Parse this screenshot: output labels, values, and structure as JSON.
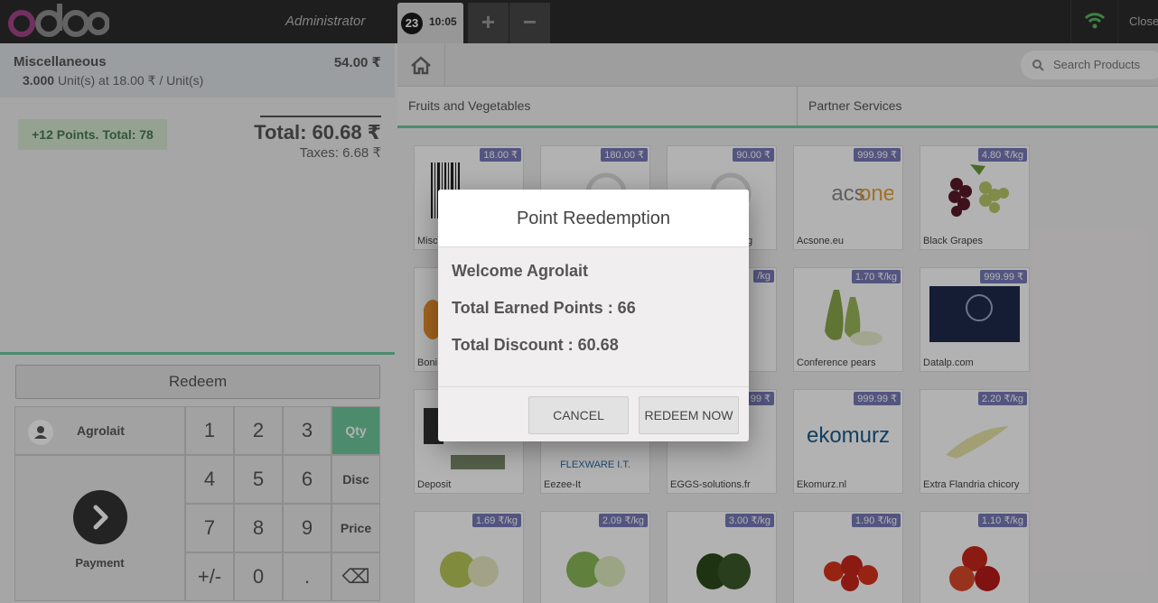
{
  "topbar": {
    "logo_text": "odoo",
    "cashier": "Administrator",
    "order_number": "23",
    "order_time": "10:05",
    "add_order_label": "+",
    "remove_order_label": "−",
    "close_label": "Close"
  },
  "order": {
    "line": {
      "product": "Miscellaneous",
      "price": "54.00 ₹",
      "quantity": "3.000",
      "info": "Unit(s) at 18.00 ₹ / Unit(s)"
    },
    "loyalty": "+12 Points. Total: 78",
    "total": "Total: 60.68 ₹",
    "taxes": "Taxes: 6.68 ₹"
  },
  "actions": {
    "redeem": "Redeem",
    "customer": "Agrolait",
    "payment": "Payment"
  },
  "numpad": {
    "keys": [
      "1",
      "2",
      "3",
      "4",
      "5",
      "6",
      "7",
      "8",
      "9",
      "+/-",
      "0",
      "."
    ],
    "modes": [
      "Qty",
      "Disc",
      "Price"
    ],
    "backspace": "⌫"
  },
  "search": {
    "placeholder": "Search Products"
  },
  "categories": [
    "Fruits and Vegetables",
    "Partner Services"
  ],
  "products": [
    {
      "name": "Miscellaneous",
      "price": "18.00 ₹"
    },
    {
      "name": "",
      "price": "180.00 ₹"
    },
    {
      "name": "",
      "price": "90.00 ₹"
    },
    {
      "name": "Acsone.eu",
      "price": "999.99 ₹"
    },
    {
      "name": "Black Grapes",
      "price": "4.80 ₹/kg"
    },
    {
      "name": "Boni",
      "price": ""
    },
    {
      "name": "",
      "price": ""
    },
    {
      "name": "",
      "price": "/kg"
    },
    {
      "name": "Conference pears",
      "price": "1.70 ₹/kg"
    },
    {
      "name": "Datalp.com",
      "price": "999.99 ₹"
    },
    {
      "name": "Deposit",
      "price": ""
    },
    {
      "name": "Eezee-It",
      "price": ""
    },
    {
      "name": "EGGS-solutions.fr",
      "price": "99 ₹"
    },
    {
      "name": "Ekomurz.nl",
      "price": "999.99 ₹"
    },
    {
      "name": "Extra Flandria chicory",
      "price": "2.20 ₹/kg"
    },
    {
      "name": "",
      "price": "1.69 ₹/kg"
    },
    {
      "name": "",
      "price": "2.09 ₹/kg"
    },
    {
      "name": "",
      "price": "3.00 ₹/kg"
    },
    {
      "name": "",
      "price": "1.90 ₹/kg"
    },
    {
      "name": "",
      "price": "1.10 ₹/kg"
    }
  ],
  "modal": {
    "title": "Point Reedemption",
    "welcome": "Welcome Agrolait",
    "earned": "Total Earned Points : 66",
    "discount": "Total Discount : 60.68",
    "cancel": "CANCEL",
    "redeem_now": "REDEEM NOW"
  },
  "colors": {
    "accent_green": "#6ec89b",
    "price_tag": "#787ab8",
    "topbar": "#2b2b2b"
  }
}
